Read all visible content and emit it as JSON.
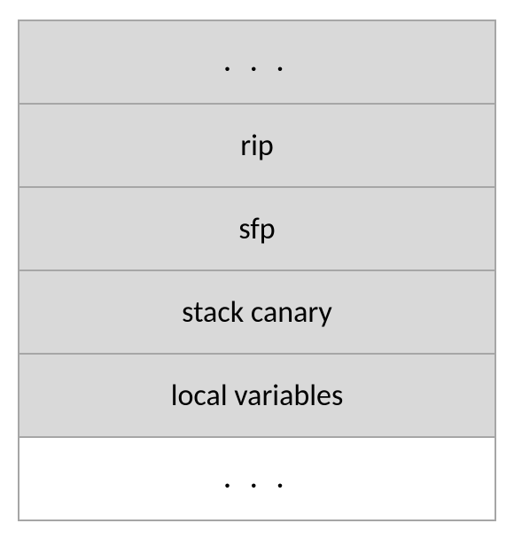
{
  "stack": {
    "rows": [
      {
        "label": ". . .",
        "filled": true,
        "dots": true
      },
      {
        "label": "rip",
        "filled": true,
        "dots": false
      },
      {
        "label": "sfp",
        "filled": true,
        "dots": false
      },
      {
        "label": "stack canary",
        "filled": true,
        "dots": false
      },
      {
        "label": "local variables",
        "filled": true,
        "dots": false
      },
      {
        "label": ". . .",
        "filled": false,
        "dots": true
      }
    ]
  }
}
